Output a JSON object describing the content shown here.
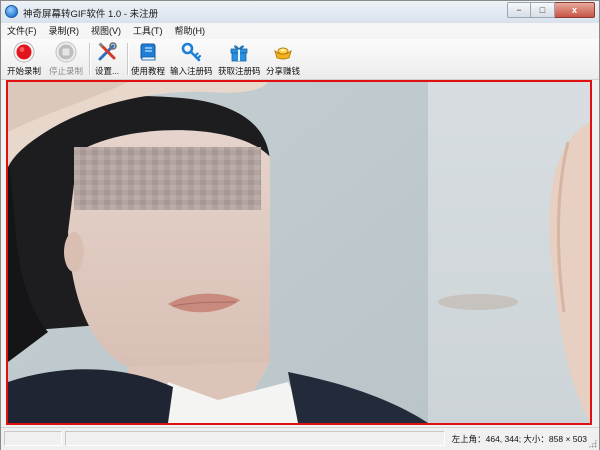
{
  "window": {
    "title": "神奇屏幕转GIF软件 1.0 - 未注册",
    "controls": {
      "minimize": "−",
      "maximize": "□",
      "close": "x"
    }
  },
  "menu": {
    "items": [
      "文件(F)",
      "录制(R)",
      "视图(V)",
      "工具(T)",
      "帮助(H)"
    ]
  },
  "toolbar": {
    "start_record": "开始录制",
    "stop_record": "停止录制",
    "settings": "设置...",
    "tutorial": "使用教程",
    "enter_code": "输入注册码",
    "get_code": "获取注册码",
    "share_earn": "分享赚钱"
  },
  "status": {
    "text": "左上角：464, 344; 大小：858 × 503"
  },
  "colors": {
    "capture_border": "#e01010",
    "record_red": "#e2141c"
  },
  "icons": [
    "app-icon",
    "record-icon",
    "stop-icon",
    "settings-tools-icon",
    "book-icon",
    "key-icon",
    "gift-icon",
    "gold-ingot-icon"
  ]
}
